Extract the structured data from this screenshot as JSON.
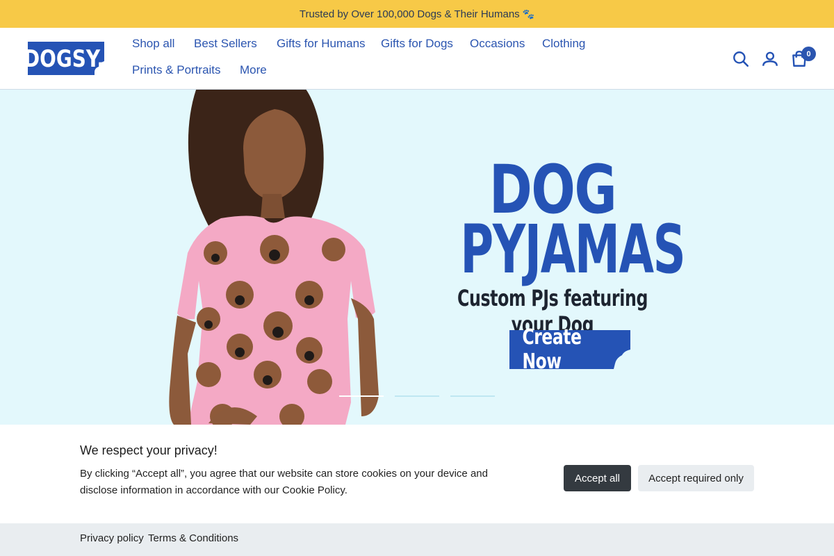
{
  "announcement": {
    "text": "Trusted by Over 100,000 Dogs & Their Humans",
    "emoji": "🐾"
  },
  "header": {
    "logo_text": "DOGSY.",
    "nav": [
      {
        "label": "Shop all"
      },
      {
        "label": "Best Sellers"
      },
      {
        "label": "Gifts for Humans"
      },
      {
        "label": "Gifts for Dogs"
      },
      {
        "label": "Occasions"
      },
      {
        "label": "Clothing"
      },
      {
        "label": "Prints & Portraits"
      },
      {
        "label": "More"
      }
    ],
    "icons": [
      "search-icon",
      "account-icon",
      "cart-icon"
    ],
    "cart_count": "0"
  },
  "hero": {
    "title_line1": "DOG",
    "title_line2": "PYJAMAS",
    "subtitle": "Custom PJs featuring your Dog",
    "cta": "Create Now",
    "slide_count": 3,
    "active_slide": 1
  },
  "consent": {
    "title": "We respect your privacy!",
    "text": "By clicking “Accept all”, you agree that our website can store cookies on your device and disclose information in accordance with our Cookie Policy.",
    "accept_all": "Accept all",
    "accept_required": "Accept required only",
    "privacy_policy": "Privacy policy",
    "terms": "Terms & Conditions"
  },
  "colors": {
    "announcement_bg": "#f7c947",
    "brand_blue": "#2553b5",
    "hero_bg": "#e3f8fc",
    "button_dark": "#343a40"
  }
}
